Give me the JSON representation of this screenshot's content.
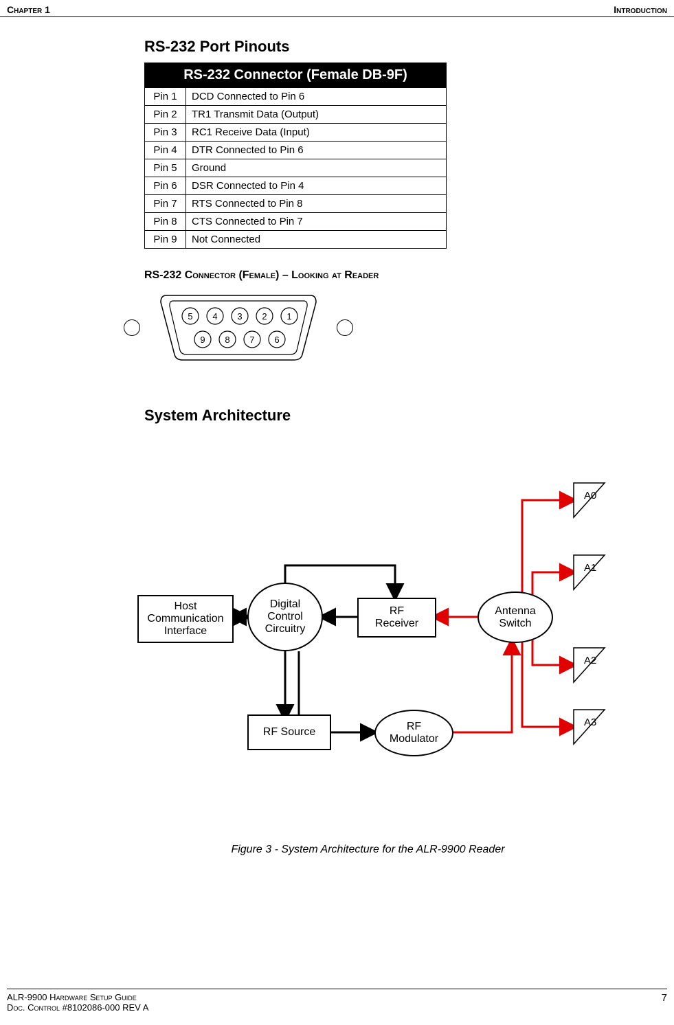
{
  "header": {
    "left": "Chapter 1",
    "right": "Introduction"
  },
  "section1": {
    "title": "RS-232 Port Pinouts",
    "table_header": "RS-232 Connector (Female DB-9F)",
    "rows": [
      {
        "pin": "Pin 1",
        "desc": "DCD Connected to Pin 6"
      },
      {
        "pin": "Pin 2",
        "desc": "TR1 Transmit Data (Output)"
      },
      {
        "pin": "Pin 3",
        "desc": "RC1 Receive Data (Input)"
      },
      {
        "pin": "Pin 4",
        "desc": "DTR Connected to Pin 6"
      },
      {
        "pin": "Pin 5",
        "desc": "Ground"
      },
      {
        "pin": "Pin 6",
        "desc": "DSR Connected to Pin 4"
      },
      {
        "pin": "Pin 7",
        "desc": "RTS Connected to Pin 8"
      },
      {
        "pin": "Pin 8",
        "desc": "CTS Connected to Pin 7"
      },
      {
        "pin": "Pin 9",
        "desc": "Not Connected"
      }
    ]
  },
  "connector_heading": "RS-232 Connector (Female) – Looking at Reader",
  "connector_pins_top": [
    "5",
    "4",
    "3",
    "2",
    "1"
  ],
  "connector_pins_bottom": [
    "9",
    "8",
    "7",
    "6"
  ],
  "section2": {
    "title": "System Architecture",
    "blocks": {
      "host": "Host\nCommunication\nInterface",
      "dcc": "Digital\nControl\nCircuitry",
      "rfrx": "RF\nReceiver",
      "antsw": "Antenna\nSwitch",
      "rfsrc": "RF Source",
      "rfmod": "RF\nModulator",
      "a0": "A0",
      "a1": "A1",
      "a2": "A2",
      "a3": "A3"
    }
  },
  "figure_caption": "Figure 3 - System Architecture for the ALR-9900 Reader",
  "footer": {
    "line1": "ALR-9900 Hardware Setup Guide",
    "line2": "Doc. Control  #8102086-000 REV A",
    "page": "7"
  }
}
